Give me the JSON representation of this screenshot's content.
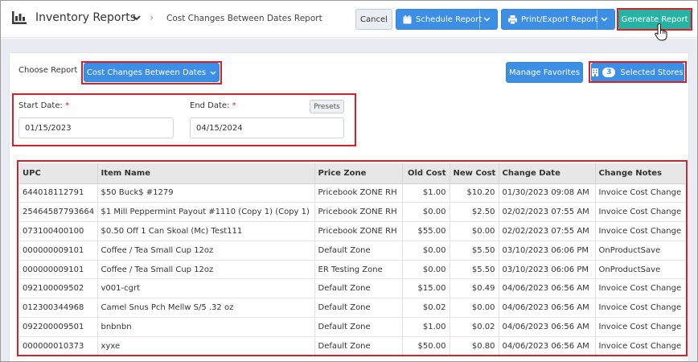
{
  "header": {
    "app_title": "Inventory Reports",
    "breadcrumb_separator": "›",
    "breadcrumb": "Cost Changes Between Dates Report",
    "cancel_label": "Cancel",
    "schedule_label": "Schedule Report",
    "print_label": "Print/Export Report",
    "generate_label": "Generate Report"
  },
  "controls": {
    "choose_label": "Choose Report",
    "choose_value": "Cost Changes Between Dates",
    "manage_favorites_label": "Manage Favorites",
    "stores_count": "3",
    "stores_label": "Selected Stores"
  },
  "dates": {
    "start_label": "Start Date:",
    "start_value": "01/15/2023",
    "end_label": "End Date:",
    "end_value": "04/15/2024",
    "required_mark": "*",
    "presets_label": "Presets"
  },
  "table": {
    "columns": [
      "UPC",
      "Item Name",
      "Price Zone",
      "Old Cost",
      "New Cost",
      "Change Date",
      "Change Notes"
    ],
    "rows": [
      [
        "644018112791",
        "$50 Buck$ #1279",
        "Pricebook ZONE RH",
        "$1.00",
        "$10.20",
        "01/30/2023 09:08 AM",
        "Invoice Cost Change"
      ],
      [
        "25464587793664",
        "$1 Mill Peppermint Payout #1110 (Copy 1) (Copy 1)",
        "Pricebook ZONE RH",
        "$0.00",
        "$2.50",
        "02/02/2023 07:55 AM",
        "Invoice Cost Change"
      ],
      [
        "073100400100",
        "$0.50 Off 1 Can Skoal (Mc) Test111",
        "Pricebook ZONE RH",
        "$55.00",
        "$0.00",
        "02/02/2023 07:55 AM",
        "Invoice Cost Change"
      ],
      [
        "000000009101",
        "Coffee / Tea Small Cup 12oz",
        "Default Zone",
        "$0.00",
        "$5.50",
        "03/10/2023 06:06 PM",
        "OnProductSave"
      ],
      [
        "000000009101",
        "Coffee / Tea Small Cup 12oz",
        "ER Testing Zone",
        "$0.00",
        "$5.50",
        "03/10/2023 06:06 PM",
        "OnProductSave"
      ],
      [
        "092100009502",
        "v001-cgrt",
        "Default Zone",
        "$15.00",
        "$0.49",
        "04/06/2023 06:56 AM",
        "Invoice Cost Change"
      ],
      [
        "012300344968",
        "Camel Snus Pch Mellw S/5 .32 oz",
        "Default Zone",
        "$0.02",
        "$0.00",
        "04/06/2023 06:56 AM",
        "Invoice Cost Change"
      ],
      [
        "092200009501",
        "bnbnbn",
        "Default Zone",
        "$1.00",
        "$0.02",
        "04/06/2023 06:56 AM",
        "Invoice Cost Change"
      ],
      [
        "000000010373",
        "xyxe",
        "Default Zone",
        "$50.00",
        "$0.80",
        "04/06/2023 06:56 AM",
        "Invoice Cost Change"
      ]
    ]
  },
  "colors": {
    "accent_blue": "#3d8ee5",
    "generate_teal": "#27b3a3",
    "highlight_red": "#d8202a"
  },
  "icons": [
    "report-app-icon",
    "chevron-down-icon",
    "calendar-icon",
    "printer-icon",
    "pointer-cursor-icon",
    "store-icon"
  ]
}
